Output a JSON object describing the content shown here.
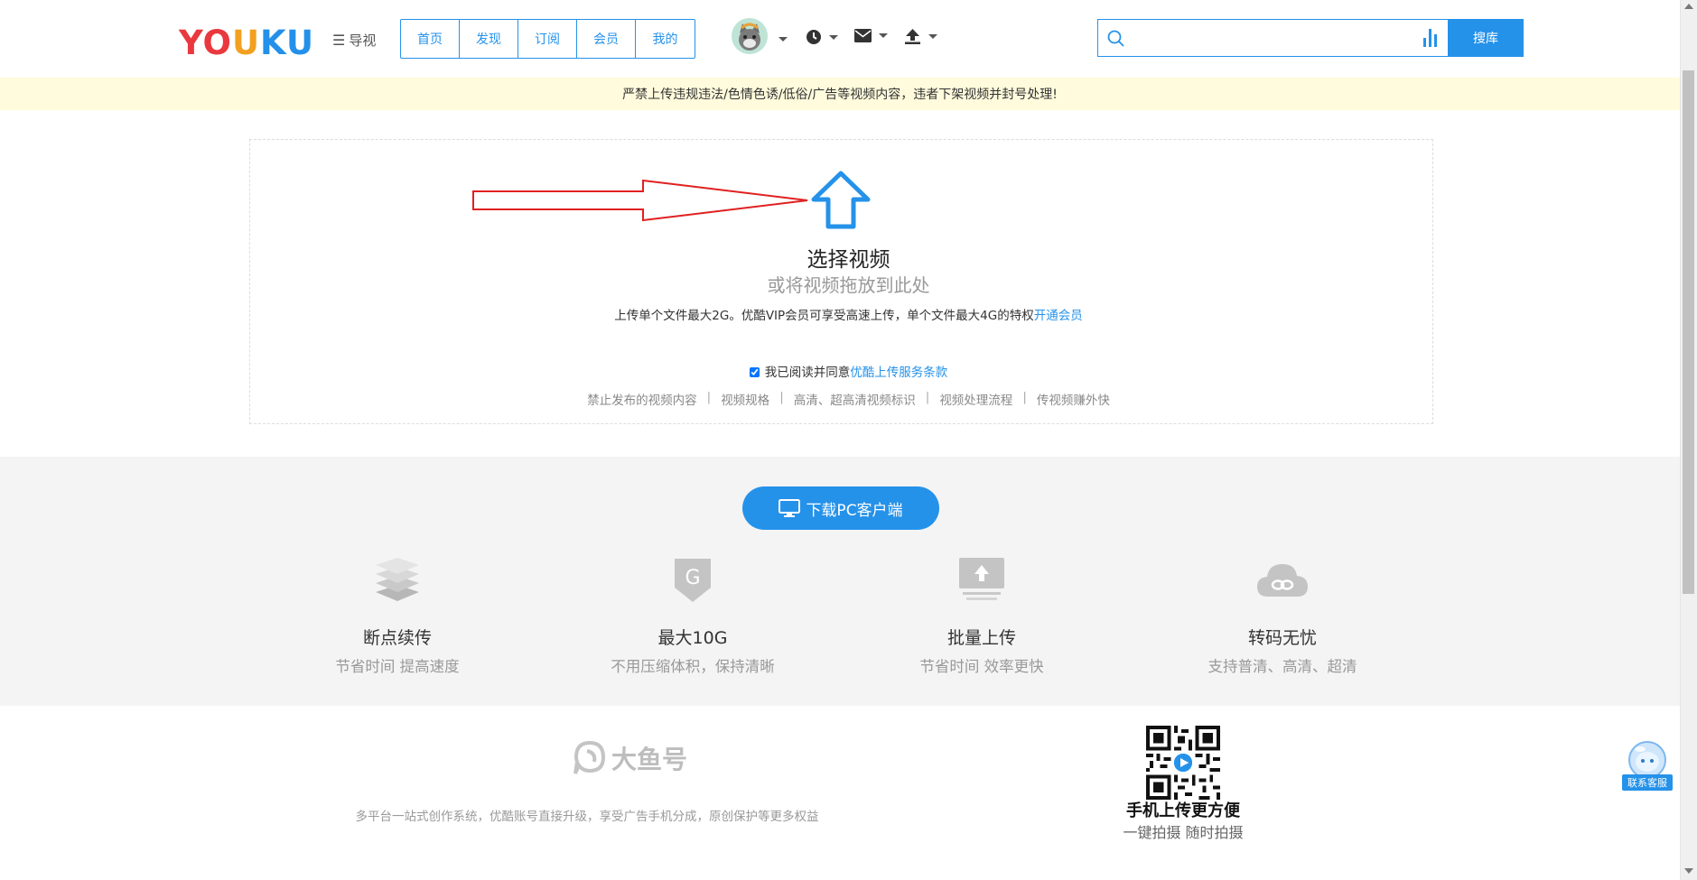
{
  "header": {
    "logo_text": "YOUKU",
    "nav_menu_label": "导视",
    "tabs": [
      "首页",
      "发现",
      "订阅",
      "会员",
      "我的"
    ],
    "search": {
      "placeholder": "",
      "button_label": "搜库"
    }
  },
  "notice": "严禁上传违规违法/色情色诱/低俗/广告等视频内容，违者下架视频并封号处理!",
  "upload": {
    "title": "选择视频",
    "subtitle": "或将视频拖放到此处",
    "limit_text": "上传单个文件最大2G。优酷VIP会员可享受高速上传，单个文件最大4G的特权",
    "limit_link": "开通会员",
    "agree_checked": true,
    "agree_text": "我已阅读并同意",
    "agree_link": "优酷上传服务条款",
    "links": [
      "禁止发布的视频内容",
      "视频规格",
      "高清、超高清视频标识",
      "视频处理流程",
      "传视频赚外快"
    ]
  },
  "download": {
    "pc_button": "下载PC客户端"
  },
  "features": [
    {
      "title": "断点续传",
      "subtitle": "节省时间 提高速度",
      "icon": "layers-icon"
    },
    {
      "title": "最大10G",
      "subtitle": "不用压缩体积，保持清晰",
      "icon": "g-badge-icon"
    },
    {
      "title": "批量上传",
      "subtitle": "节省时间 效率更快",
      "icon": "batch-upload-icon"
    },
    {
      "title": "转码无忧",
      "subtitle": "支持普清、高清、超清",
      "icon": "cloud-icon"
    }
  ],
  "dayu": {
    "logo_text": "大鱼号",
    "description": "多平台一站式创作系统，优酷账号直接升级，享受广告手机分成，原创保护等更多权益"
  },
  "mobile": {
    "title": "手机上传更方便",
    "subtitle": "一键拍摄 随时拍摄"
  },
  "service": {
    "label": "联系客服"
  },
  "colors": {
    "accent": "#2592ea",
    "notice_bg": "#fffbdc",
    "grey_bg": "#f4f4f4",
    "arrow": "#e02020"
  }
}
